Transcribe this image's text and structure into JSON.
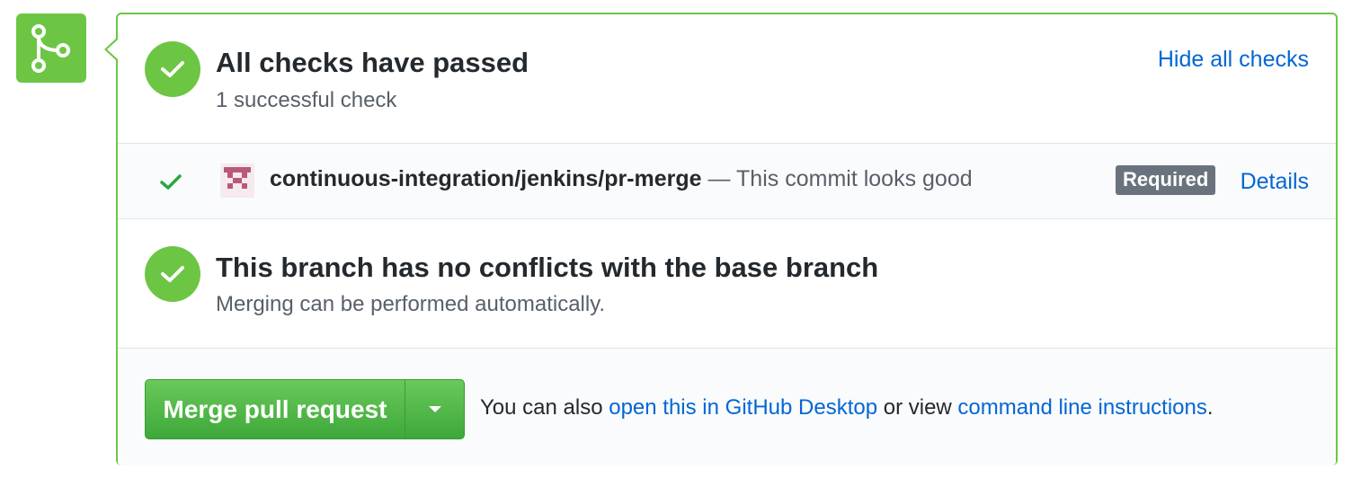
{
  "colors": {
    "success": "#6cc644",
    "link": "#0366d6",
    "badge": "#6a737d"
  },
  "icons": {
    "merge": "git-merge-icon",
    "status": "check-circle-icon",
    "check": "check-icon",
    "avatar": "jenkins-avatar-icon",
    "dropdown": "caret-down-icon"
  },
  "checks_summary": {
    "title": "All checks have passed",
    "subtitle": "1 successful check",
    "toggle_label": "Hide all checks"
  },
  "checks": [
    {
      "name": "continuous-integration/jenkins/pr-merge",
      "description": " — This commit looks good",
      "badge": "Required",
      "details_label": "Details"
    }
  ],
  "conflicts": {
    "title": "This branch has no conflicts with the base branch",
    "subtitle": "Merging can be performed automatically."
  },
  "merge": {
    "button_label": "Merge pull request",
    "also_prefix": "You can also ",
    "desktop_link": "open this in GitHub Desktop",
    "middle_text": " or view ",
    "cli_link": "command line instructions",
    "suffix": "."
  }
}
